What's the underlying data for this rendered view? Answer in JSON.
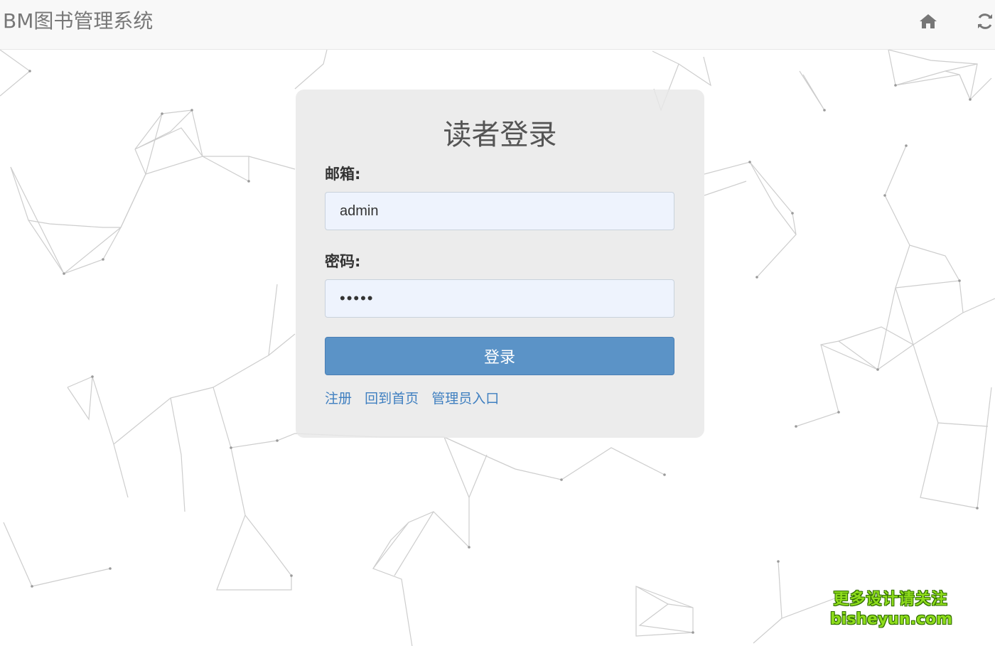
{
  "navbar": {
    "brand": "BM图书管理系统",
    "home_icon": "home-icon",
    "refresh_icon": "refresh-icon"
  },
  "login": {
    "title": "读者登录",
    "email_label": "邮箱:",
    "email_value": "admin",
    "password_label": "密码:",
    "password_value": "admin",
    "submit_label": "登录",
    "links": [
      "注册",
      "回到首页",
      "管理员入口"
    ]
  },
  "watermark": {
    "line1": "更多设计请关注",
    "line2": "bisheyun.com"
  },
  "colors": {
    "navbar_bg": "#f8f8f8",
    "card_bg": "#e8e8e8",
    "button_bg": "#5b93c7",
    "link": "#3f7fc0",
    "input_bg": "#eef3fd"
  }
}
